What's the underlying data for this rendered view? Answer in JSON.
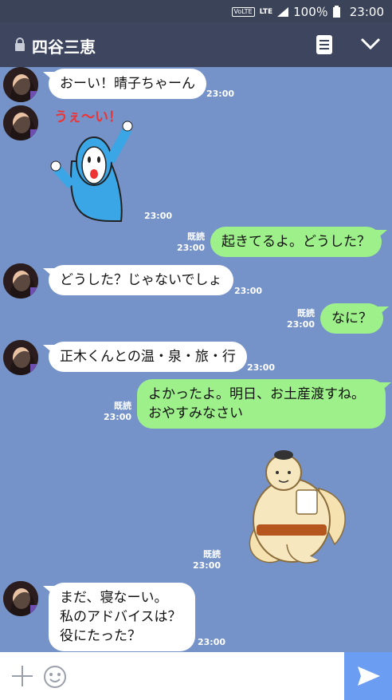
{
  "status_bar": {
    "volte": "VoLTE",
    "lte": "LTE",
    "battery": "100％",
    "clock": "23:00"
  },
  "header": {
    "title": "四谷三恵"
  },
  "messages": [
    {
      "dir": "in",
      "text": "おーい！晴子ちゃーん",
      "time": "23:00"
    },
    {
      "dir": "in",
      "sticker": "cheering-character-sticker",
      "sticker_text": "うぇ〜い！",
      "time": "23:00"
    },
    {
      "dir": "out",
      "read": "既読",
      "text": "起きてるよ。どうした？",
      "time": "23:00"
    },
    {
      "dir": "in",
      "text": "どうした？じゃないでしょ",
      "time": "23:00"
    },
    {
      "dir": "out",
      "read": "既読",
      "text": "なに？",
      "time": "23:00"
    },
    {
      "dir": "in",
      "text": "正木くんとの温・泉・旅・行",
      "time": "23:00"
    },
    {
      "dir": "out",
      "read": "既読",
      "line1": "よかったよ。明日、お土産渡すね。",
      "line2": "おやすみなさい",
      "time": "23:00"
    },
    {
      "dir": "out",
      "read": "既読",
      "sticker": "sumo-wrestler-sticker",
      "time": "23:00"
    },
    {
      "dir": "in",
      "line1": "まだ、寝なーい。",
      "line2": "私のアドバイスは？",
      "line3": "役にたった？",
      "time": "23:00"
    }
  ],
  "colors": {
    "chat_bg": "#7593c8",
    "header_bg": "#3d465e",
    "outgoing": "#9ef08a",
    "send": "#6b9df2"
  }
}
